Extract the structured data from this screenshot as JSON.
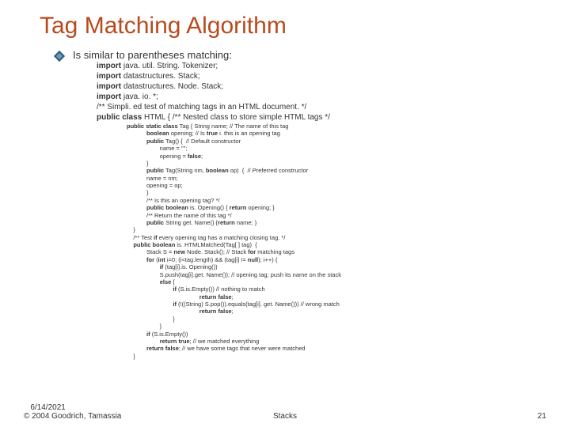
{
  "title": "Tag Matching Algorithm",
  "bullet": "Is similar to parentheses matching:",
  "code_main": [
    {
      "kw": "import",
      "rest": " java. util. String. Tokenizer;"
    },
    {
      "kw": "import",
      "rest": " datastructures. Stack;"
    },
    {
      "kw": "import",
      "rest": " datastructures. Node. Stack;"
    },
    {
      "kw": "import",
      "rest": " java. io. *;"
    },
    {
      "kw": "",
      "rest": "/** Simpli. ed test of matching tags in an HTML document. */"
    }
  ],
  "code_class": {
    "kw": "public class",
    "mid": " HTML { /** Nested class to store simple HTML tags */"
  },
  "code_sub": "public static class Tag { String name; // The name of this tag\n            boolean opening; // Is true i. this is an opening tag\n            public Tag() {  // Default constructor\n                    name = \"\";\n                    opening = false;\n            }\n            public Tag(String nm, boolean op)  {  // Preferred constructor\n            name = nm;\n            opening = op;\n            }\n            /** Is this an opening tag? */\n            public boolean is. Opening() { return opening; }\n            /** Return the name of this tag */\n            public String get. Name() {return name; }\n    }\n    /** Test if every opening tag has a matching closing tag. */\n    public boolean is. HTMLMatched(Tag[ ] tag)  {\n            Stack S = new Node. Stack(); // Stack for matching tags\n            for (int i=0; (i<tag.length) && (tag[i] != null); i++) {\n                    if (tag[i].is. Opening())\n                    S.push(tag[i].get. Name()); // opening tag; push its name on the stack\n                    else {\n                            if (S.is.Empty()) // nothing to match\n                                            return false;\n                            if (!((String) S.pop()).equals(tag[i]. get. Name())) // wrong match\n                                            return false;\n                            }\n                    }\n            if (S.is.Empty())\n                    return true; // we matched everything\n            return false; // we have some tags that never were matched\n    }",
  "footer": {
    "left": "   6/14/2021\n© 2004 Goodrich, Tamassia",
    "center": "Stacks",
    "right": "21"
  }
}
